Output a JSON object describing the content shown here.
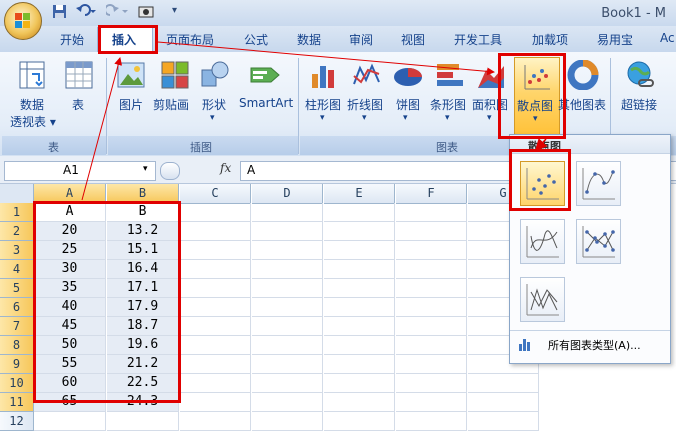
{
  "window": {
    "title": "Book1 - M"
  },
  "quick_access": {
    "more": "▾"
  },
  "tabs": [
    "开始",
    "插入",
    "页面布局",
    "公式",
    "数据",
    "审阅",
    "视图",
    "开发工具",
    "加载项",
    "易用宝",
    "Ac"
  ],
  "ribbon": {
    "groups": {
      "table": {
        "label": "表",
        "pivot": "数据",
        "pivot2": "透视表",
        "table": "表"
      },
      "illus": {
        "label": "插图",
        "picture": "图片",
        "clipart": "剪贴画",
        "shapes": "形状",
        "smartart": "SmartArt"
      },
      "charts": {
        "label": "图表",
        "column": "柱形图",
        "line": "折线图",
        "pie": "饼图",
        "bar": "条形图",
        "area": "面积图",
        "scatter": "散点图",
        "other": "其他图表"
      },
      "links": {
        "hyperlink": "超链接"
      }
    },
    "dropdown_arrow": "▾"
  },
  "formula_bar": {
    "name_box": "A1",
    "fx": "fx",
    "value": "A"
  },
  "columns": [
    "A",
    "B",
    "C",
    "D",
    "E",
    "F",
    "G"
  ],
  "rows": [
    "1",
    "2",
    "3",
    "4",
    "5",
    "6",
    "7",
    "8",
    "9",
    "10",
    "11",
    "12"
  ],
  "cells": {
    "A": [
      "A",
      "20",
      "25",
      "30",
      "35",
      "40",
      "45",
      "50",
      "55",
      "60",
      "65"
    ],
    "B": [
      "B",
      "13.2",
      "15.1",
      "16.4",
      "17.1",
      "17.9",
      "18.7",
      "19.6",
      "21.2",
      "22.5",
      "24.3"
    ]
  },
  "scatter_menu": {
    "title": "散点图",
    "options": [
      "仅带数据标记的散点图",
      "带平滑线和数据标记的散点图",
      "带平滑线的散点图",
      "带直线和数据标记的散点图",
      "带直线的散点图"
    ],
    "all_types": "所有图表类型(A)..."
  },
  "colors": {
    "highlight_red": "#e00000",
    "ribbon_blue": "#15428b",
    "selected_orange": "#f7c75a"
  }
}
